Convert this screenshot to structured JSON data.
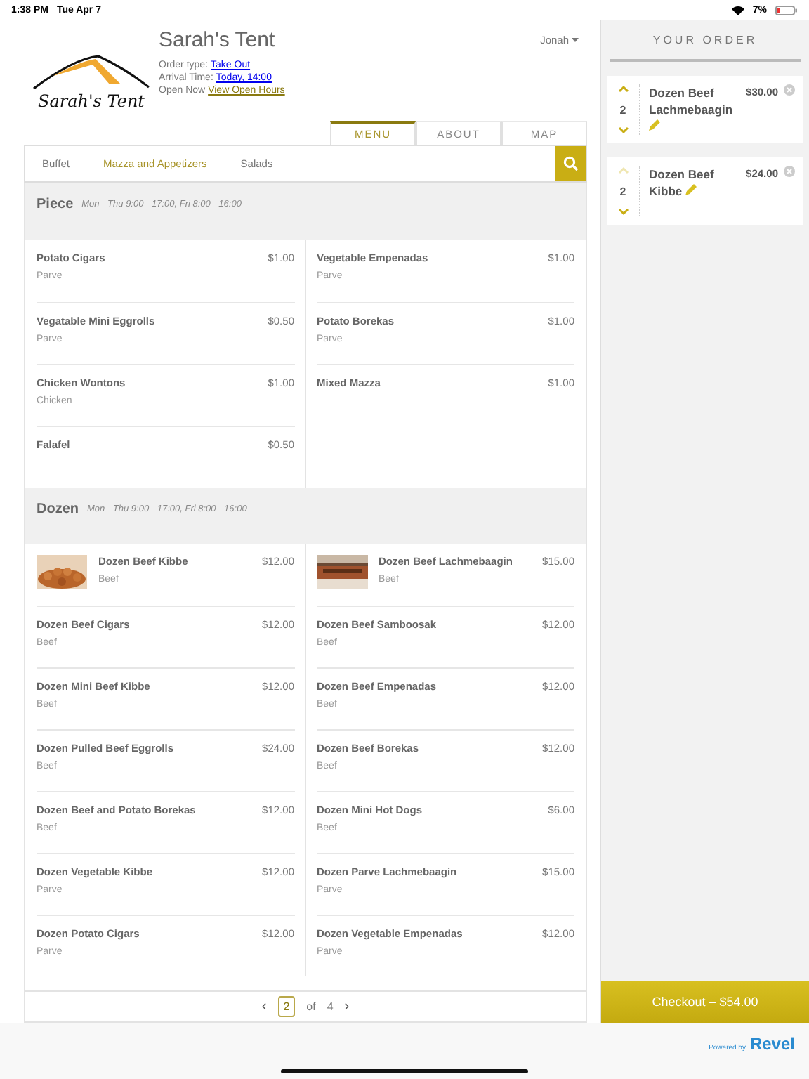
{
  "status_bar": {
    "time": "1:38 PM",
    "date": "Tue Apr 7",
    "battery": "7%"
  },
  "restaurant": {
    "logo_text": "Sarah's Tent",
    "name": "Sarah's Tent",
    "order_type_label": "Order type:",
    "order_type": "Take Out",
    "arrival_label": "Arrival Time:",
    "arrival": "Today, 14:00",
    "open_label": "Open Now",
    "open_hours_link": "View Open Hours"
  },
  "user": {
    "name": "Jonah"
  },
  "tabs": [
    {
      "label": "MENU",
      "selected": true
    },
    {
      "label": "ABOUT",
      "selected": false
    },
    {
      "label": "MAP",
      "selected": false
    }
  ],
  "categories": [
    {
      "label": "Buffet",
      "selected": false
    },
    {
      "label": "Mazza and Appetizers",
      "selected": true
    },
    {
      "label": "Salads",
      "selected": false
    }
  ],
  "sections": [
    {
      "title": "Piece",
      "hours": "Mon - Thu 9:00 - 17:00, Fri 8:00 - 16:00",
      "items": [
        {
          "name": "Potato Cigars",
          "price": "$1.00",
          "note": "Parve"
        },
        {
          "name": "Vegetable Empenadas",
          "price": "$1.00",
          "note": "Parve"
        },
        {
          "name": "Vegatable Mini Eggrolls",
          "price": "$0.50",
          "note": "Parve"
        },
        {
          "name": "Potato Borekas",
          "price": "$1.00",
          "note": "Parve"
        },
        {
          "name": "Chicken Wontons",
          "price": "$1.00",
          "note": "Chicken"
        },
        {
          "name": "Mixed Mazza",
          "price": "$1.00"
        },
        {
          "name": "Falafel",
          "price": "$0.50"
        }
      ]
    },
    {
      "title": "Dozen",
      "hours": "Mon - Thu 9:00 - 17:00, Fri 8:00 - 16:00",
      "items": [
        {
          "name": "Dozen Beef Kibbe",
          "price": "$12.00",
          "note": "Beef"
        },
        {
          "name": "Dozen Beef Lachmebaagin",
          "price": "$15.00",
          "note": "Beef"
        },
        {
          "name": "Dozen Beef Cigars",
          "price": "$12.00",
          "note": "Beef"
        },
        {
          "name": "Dozen Beef Samboosak",
          "price": "$12.00",
          "note": "Beef"
        },
        {
          "name": "Dozen Mini Beef Kibbe",
          "price": "$12.00",
          "note": "Beef"
        },
        {
          "name": "Dozen Beef Empenadas",
          "price": "$12.00",
          "note": "Beef"
        },
        {
          "name": "Dozen Pulled Beef Eggrolls",
          "price": "$24.00",
          "note": "Beef"
        },
        {
          "name": "Dozen Beef Borekas",
          "price": "$12.00",
          "note": "Beef"
        },
        {
          "name": "Dozen Beef and Potato Borekas",
          "price": "$12.00",
          "note": "Beef"
        },
        {
          "name": "Dozen Mini Hot Dogs",
          "price": "$6.00",
          "note": "Beef"
        },
        {
          "name": "Dozen Vegetable Kibbe",
          "price": "$12.00",
          "note": "Parve"
        },
        {
          "name": "Dozen Parve Lachmebaagin",
          "price": "$15.00",
          "note": "Parve"
        },
        {
          "name": "Dozen Potato Cigars",
          "price": "$12.00",
          "note": "Parve"
        },
        {
          "name": "Dozen Vegetable Empenadas",
          "price": "$12.00",
          "note": "Parve"
        }
      ]
    }
  ],
  "pagination": {
    "prev": "‹",
    "current": "2",
    "of": "of",
    "total": "4",
    "next": "›"
  },
  "order": {
    "title": "YOUR ORDER",
    "items": [
      {
        "quantity": "2",
        "name": "Dozen Beef Lachmebaagin",
        "price": "$30.00",
        "increase_disabled": false
      },
      {
        "quantity": "2",
        "name": "Dozen Beef Kibbe",
        "price": "$24.00",
        "increase_disabled": true
      }
    ],
    "checkout": "Checkout – $54.00"
  },
  "footer": {
    "powered_by": "Powered by",
    "brand": "Revel"
  }
}
